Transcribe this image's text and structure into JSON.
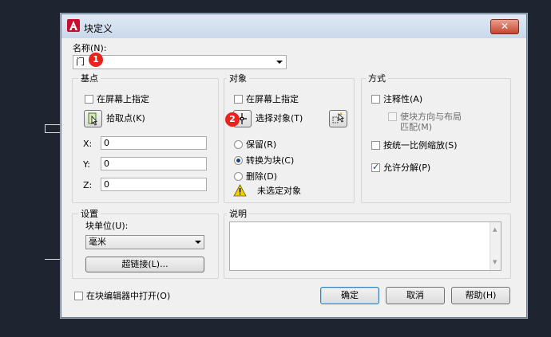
{
  "dialog": {
    "title": "块定义"
  },
  "name": {
    "label": "名称(N):",
    "value": "门"
  },
  "annotations": {
    "badge1": "1",
    "badge2": "2"
  },
  "basepoint": {
    "title": "基点",
    "specify_on_screen": "在屏幕上指定",
    "pick_point": "拾取点(K)",
    "x_label": "X:",
    "x_value": "0",
    "y_label": "Y:",
    "y_value": "0",
    "z_label": "Z:",
    "z_value": "0"
  },
  "objects": {
    "title": "对象",
    "specify_on_screen": "在屏幕上指定",
    "select_objects": "选择对象(T)",
    "retain": "保留(R)",
    "convert": "转换为块(C)",
    "delete": "删除(D)",
    "warning": "未选定对象"
  },
  "behavior": {
    "title": "方式",
    "annotative": "注释性(A)",
    "match_orientation_line1": "使块方向与布局",
    "match_orientation_line2": "匹配(M)",
    "scale_uniformly": "按统一比例缩放(S)",
    "allow_exploding": "允许分解(P)"
  },
  "settings": {
    "title": "设置",
    "unit_label": "块单位(U):",
    "unit_value": "毫米",
    "hyperlink": "超链接(L)..."
  },
  "description": {
    "title": "说明"
  },
  "footer": {
    "open_in_editor": "在块编辑器中打开(O)",
    "ok": "确定",
    "cancel": "取消",
    "help": "帮助(H)"
  },
  "colors": {
    "badge": "#e8221c",
    "titlebar": "#c9d8ea",
    "close": "#c6452f"
  }
}
